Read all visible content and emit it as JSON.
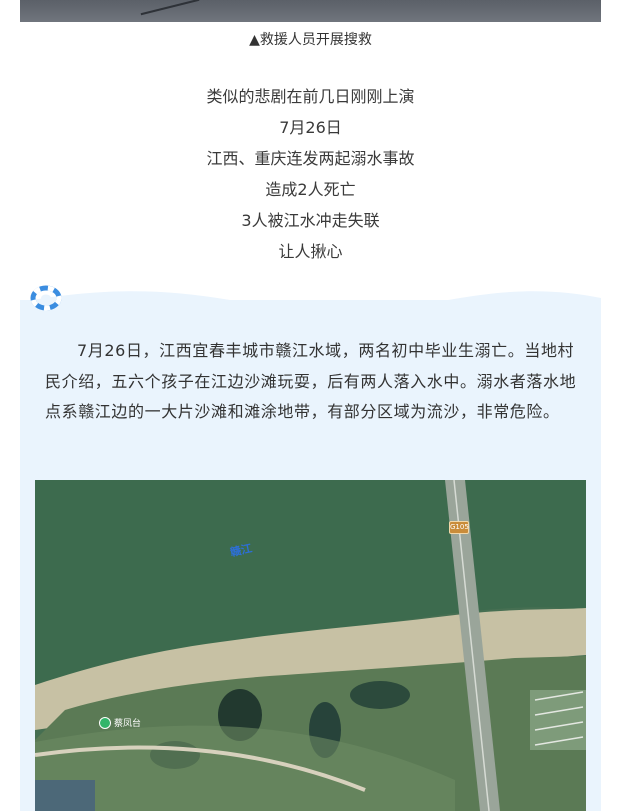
{
  "caption": "▲救援人员开展搜救",
  "center_lines": [
    "类似的悲剧在前几日刚刚上演",
    "7月26日",
    "江西、重庆连发两起溺水事故",
    "造成2人死亡",
    "3人被江水冲走失联",
    "让人揪心"
  ],
  "paragraph": "7月26日，江西宜春丰城市赣江水域，两名初中毕业生溺亡。当地村民介绍，五六个孩子在江边沙滩玩耍，后有两人落入水中。溺水者落水地点系赣江边的一大片沙滩和滩涂地带，有部分区域为流沙，非常危险。",
  "map": {
    "river_label": "赣江",
    "road_shield": "G105",
    "poi_label": "蔡凤台"
  },
  "colors": {
    "panel_bg": "#eaf4fd",
    "accent_blue": "#3b8de0"
  }
}
